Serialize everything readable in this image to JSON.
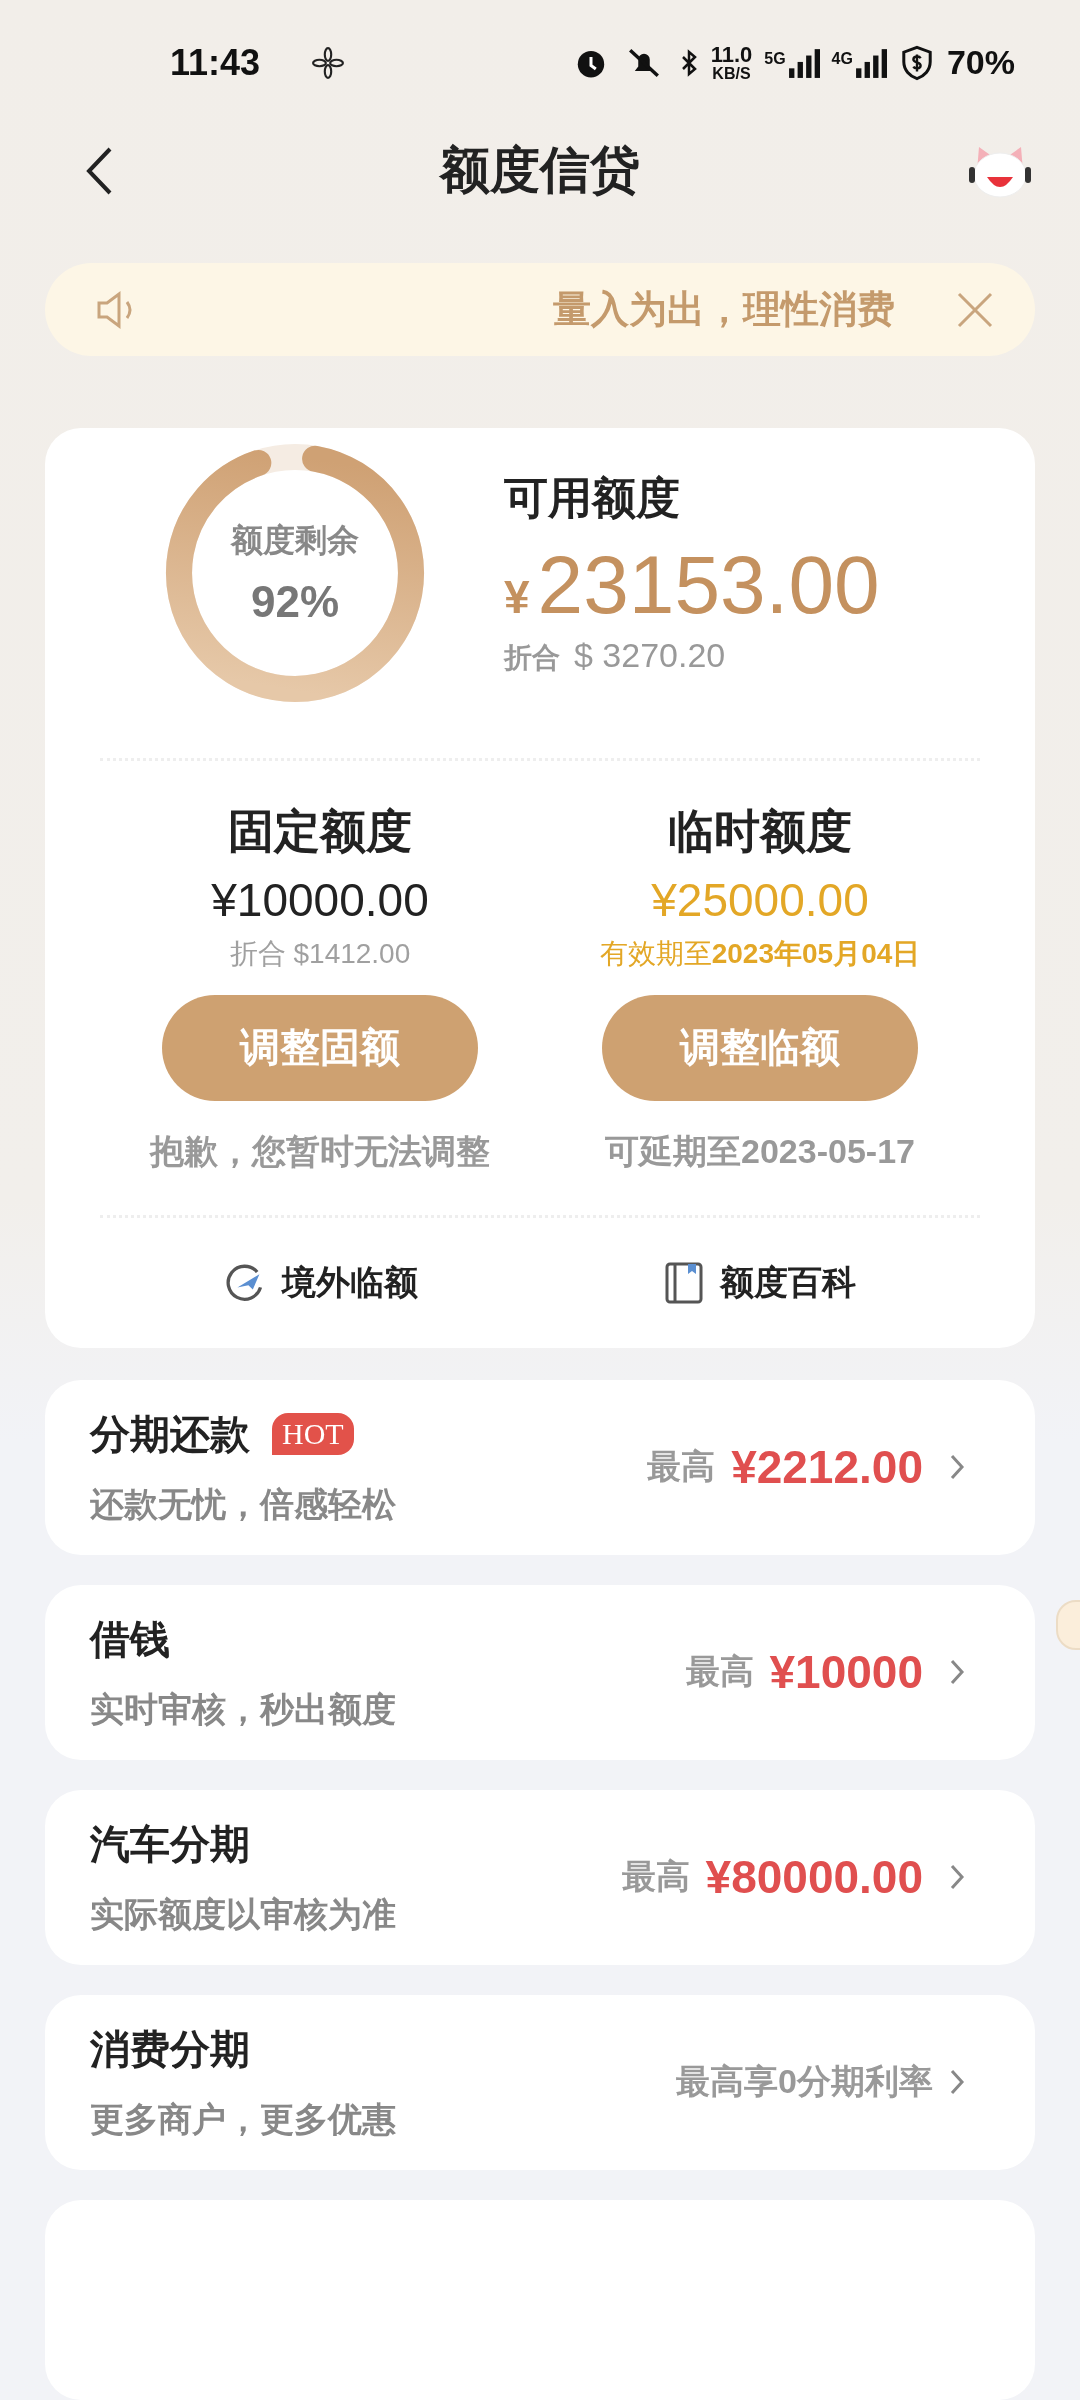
{
  "status_bar": {
    "time": "11:43",
    "network_speed": "11.0",
    "speed_unit": "KB/S",
    "network_5g": "5G",
    "network_4g": "4G",
    "battery": "70%"
  },
  "nav": {
    "title": "额度信贷"
  },
  "notice": {
    "text": "量入为出，理性消费"
  },
  "summary": {
    "ring_label": "额度剩余",
    "ring_percent": "92%",
    "level": 0.92,
    "title": "可用额度",
    "currency": "¥",
    "amount": "23153.00",
    "converted_label": "折合",
    "converted": "$ 3270.20"
  },
  "quotas": [
    {
      "kind": "fixed",
      "title": "固定额度",
      "amount": "¥10000.00",
      "note": "折合 $1412.00",
      "button": "调整固额",
      "hint": "抱歉，您暂时无法调整"
    },
    {
      "kind": "temporary",
      "title": "临时额度",
      "amount": "¥25000.00",
      "note": "有效期至**2023年05月04日**",
      "button": "调整临额",
      "hint": "可延期至2023-05-17"
    }
  ],
  "links": [
    {
      "kind": "plane",
      "label": "境外临额"
    },
    {
      "kind": "book",
      "label": "额度百科"
    }
  ],
  "products": [
    {
      "title": "分期还款",
      "badge": "HOT",
      "subtitle": "还款无忧，倍感轻松",
      "prefix": "最高",
      "amount": "¥2212.00"
    },
    {
      "title": "借钱",
      "subtitle": "实时审核，秒出额度",
      "prefix": "最高",
      "amount": "¥10000"
    },
    {
      "title": "汽车分期",
      "subtitle": "实际额度以审核为准",
      "prefix": "最高",
      "amount": "¥80000.00"
    },
    {
      "title": "消费分期",
      "subtitle": "更多商户，更多优惠",
      "prefix": "最高享0分期利率"
    }
  ]
}
